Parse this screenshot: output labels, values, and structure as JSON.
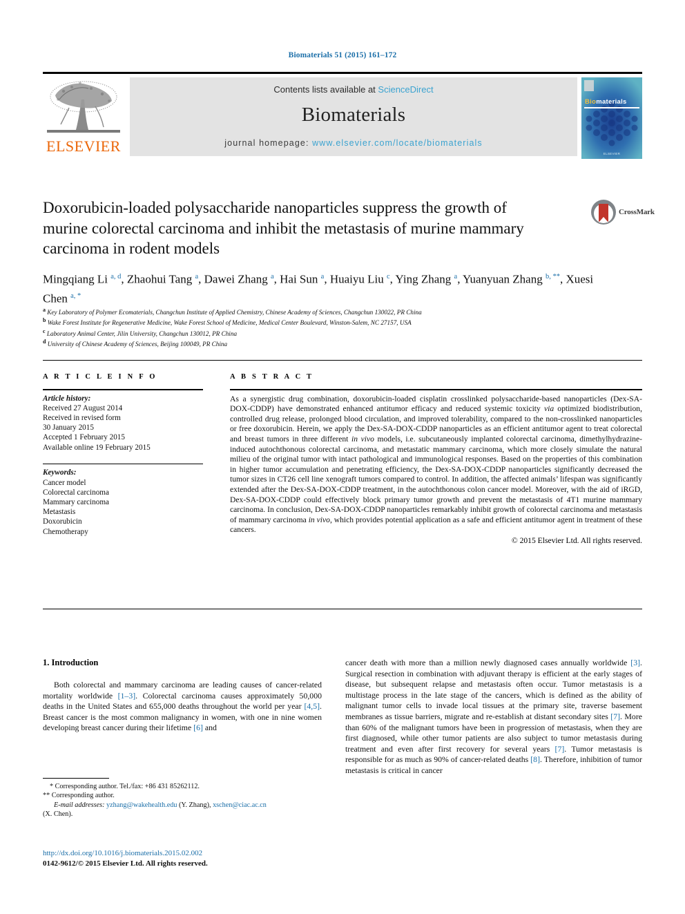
{
  "running_head": "Biomaterials 51 (2015) 161–172",
  "banner": {
    "contents_prefix": "Contents lists available at ",
    "contents_link": "ScienceDirect",
    "journal_name": "Biomaterials",
    "homepage_prefix": "journal homepage: ",
    "homepage_url": "www.elsevier.com/locate/biomaterials",
    "publisher": "ELSEVIER",
    "cover": {
      "title_b": "Bio",
      "title_rest": "materials",
      "footer": "ELSEVIER"
    },
    "colors": {
      "link_blue": "#3ba3d0",
      "elsevier_orange": "#eb6608",
      "banner_grey": "#e3e3e3"
    }
  },
  "crossmark": {
    "label": "CrossMark"
  },
  "article": {
    "title": "Doxorubicin-loaded polysaccharide nanoparticles suppress the growth of murine colorectal carcinoma and inhibit the metastasis of murine mammary carcinoma in rodent models",
    "authors_html": "Mingqiang Li <sup>a, d</sup>, Zhaohui Tang <sup>a</sup>, Dawei Zhang <sup>a</sup>, Hai Sun <sup>a</sup>, Huaiyu Liu <sup>c</sup>, Ying Zhang <sup>a</sup>, Yuanyuan Zhang <sup>b, **</sup>, Xuesi Chen <sup>a, *</sup>",
    "affiliations": [
      {
        "marker": "a",
        "text": "Key Laboratory of Polymer Ecomaterials, Changchun Institute of Applied Chemistry, Chinese Academy of Sciences, Changchun 130022, PR China"
      },
      {
        "marker": "b",
        "text": "Wake Forest Institute for Regenerative Medicine, Wake Forest School of Medicine, Medical Center Boulevard, Winston-Salem, NC 27157, USA"
      },
      {
        "marker": "c",
        "text": "Laboratory Animal Center, Jilin University, Changchun 130012, PR China"
      },
      {
        "marker": "d",
        "text": "University of Chinese Academy of Sciences, Beijing 100049, PR China"
      }
    ]
  },
  "article_info": {
    "heading": "A R T I C L E  I N F O",
    "history_label": "Article history:",
    "history": [
      "Received 27 August 2014",
      "Received in revised form",
      "30 January 2015",
      "Accepted 1 February 2015",
      "Available online 19 February 2015"
    ],
    "keywords_label": "Keywords:",
    "keywords": [
      "Cancer model",
      "Colorectal carcinoma",
      "Mammary carcinoma",
      "Metastasis",
      "Doxorubicin",
      "Chemotherapy"
    ]
  },
  "abstract": {
    "heading": "A B S T R A C T",
    "text_html": "As a synergistic drug combination, doxorubicin-loaded cisplatin crosslinked polysaccharide-based nanoparticles (Dex-SA-DOX-CDDP) have demonstrated enhanced antitumor efficacy and reduced systemic toxicity <i>via</i> optimized biodistribution, controlled drug release, prolonged blood circulation, and improved tolerability, compared to the non-crosslinked nanoparticles or free doxorubicin. Herein, we apply the Dex-SA-DOX-CDDP nanoparticles as an efficient antitumor agent to treat colorectal and breast tumors in three different <i>in vivo</i> models, i.e. subcutaneously implanted colorectal carcinoma, dimethylhydrazine-induced autochthonous colorectal carcinoma, and metastatic mammary carcinoma, which more closely simulate the natural milieu of the original tumor with intact pathological and immunological responses. Based on the properties of this combination in higher tumor accumulation and penetrating efficiency, the Dex-SA-DOX-CDDP nanoparticles significantly decreased the tumor sizes in CT26 cell line xenograft tumors compared to control. In addition, the affected animals&rsquo; lifespan was significantly extended after the Dex-SA-DOX-CDDP treatment, in the autochthonous colon cancer model. Moreover, with the aid of iRGD, Dex-SA-DOX-CDDP could effectively block primary tumor growth and prevent the metastasis of 4T1 murine mammary carcinoma. In conclusion, Dex-SA-DOX-CDDP nanoparticles remarkably inhibit growth of colorectal carcinoma and metastasis of mammary carcinoma <i>in vivo</i>, which provides potential application as a safe and efficient antitumor agent in treatment of these cancers.",
    "copyright": "© 2015 Elsevier Ltd. All rights reserved."
  },
  "body": {
    "section_title": "1. Introduction",
    "left_html": "<p>Both colorectal and mammary carcinoma are leading causes of cancer-related mortality worldwide <span class=\"ref\">[1&ndash;3]</span>. Colorectal carcinoma causes approximately 50,000 deaths in the United States and 655,000 deaths throughout the world per year <span class=\"ref\">[4,5]</span>. Breast cancer is the most common malignancy in women, with one in nine women developing breast cancer during their lifetime <span class=\"ref\">[6]</span> and</p>",
    "right_html": "<p style=\"text-indent:0\">cancer death with more than a million newly diagnosed cases annually worldwide <span class=\"ref\">[3]</span>. Surgical resection in combination with adjuvant therapy is efficient at the early stages of disease, but subsequent relapse and metastasis often occur. Tumor metastasis is a multistage process in the late stage of the cancers, which is defined as the ability of malignant tumor cells to invade local tissues at the primary site, traverse basement membranes as tissue barriers, migrate and re-establish at distant secondary sites <span class=\"ref\">[7]</span>. More than 60% of the malignant tumors have been in progression of metastasis, when they are first diagnosed, while other tumor patients are also subject to tumor metastasis during treatment and even after first recovery for several years <span class=\"ref\">[7]</span>. Tumor metastasis is responsible for as much as 90% of cancer-related deaths <span class=\"ref\">[8]</span>. Therefore, inhibition of tumor metastasis is critical in cancer</p>"
  },
  "footnotes": {
    "corresponding_1": "* Corresponding author. Tel./fax: +86 431 85262112.",
    "corresponding_2": "** Corresponding author.",
    "email_label": "E-mail addresses:",
    "email_1": "yzhang@wakehealth.edu",
    "email_1_who": "(Y. Zhang)",
    "email_2": "xschen@ciac.ac.cn",
    "email_2_who": "(X. Chen)."
  },
  "doi": {
    "url": "http://dx.doi.org/10.1016/j.biomaterials.2015.02.002",
    "issn_line": "0142-9612/© 2015 Elsevier Ltd. All rights reserved."
  }
}
